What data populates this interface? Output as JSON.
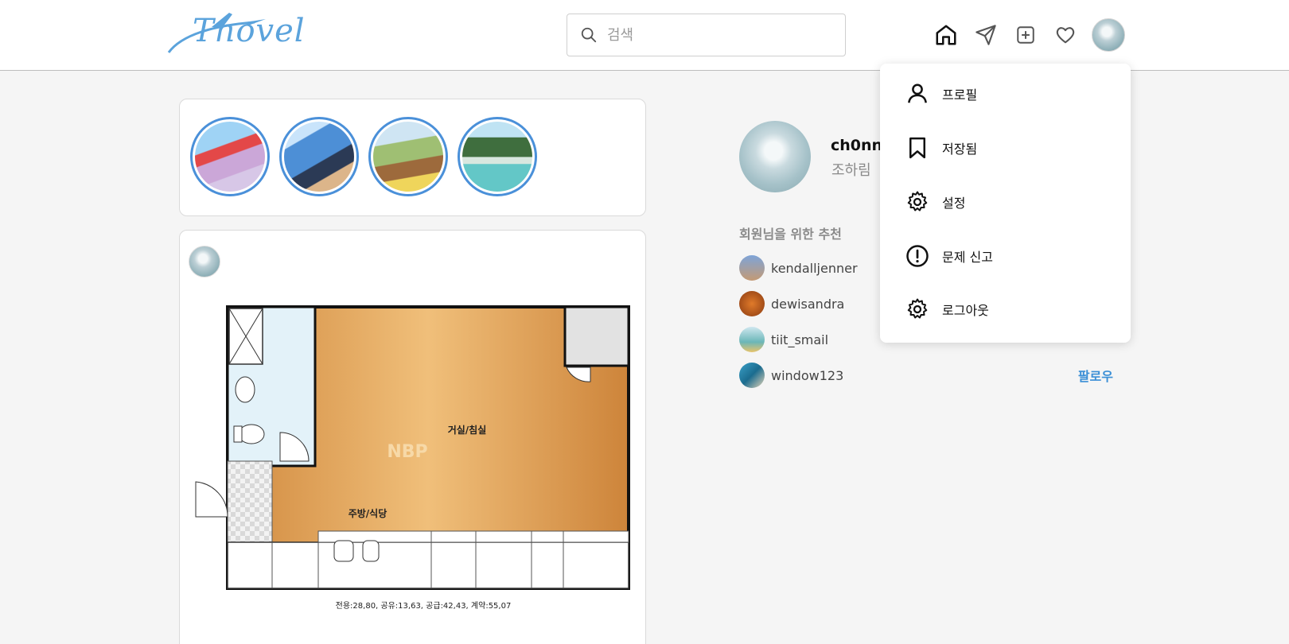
{
  "header": {
    "logo_text": "Tnovel",
    "search": {
      "placeholder": "검색",
      "value": ""
    },
    "icons": [
      "home-icon",
      "send-icon",
      "add-post-icon",
      "heart-icon",
      "profile-avatar"
    ]
  },
  "stories": [
    "story-1",
    "story-2",
    "story-3",
    "story-4"
  ],
  "post": {
    "floorplan": {
      "room_label": "거실/침실",
      "kitchen_label": "주방/식당",
      "watermark": "NBP",
      "area_caption": "전용:28,80, 공유:13,63, 공급:42,43, 계약:55,07"
    }
  },
  "sidebar": {
    "username": "ch0nn",
    "name": "조하림",
    "recommend_title": "회원님을 위한 추천",
    "recommendations": [
      {
        "username": "kendalljenner",
        "follow_label": ""
      },
      {
        "username": "dewisandra",
        "follow_label": ""
      },
      {
        "username": "tiit_smail",
        "follow_label": ""
      },
      {
        "username": "window123",
        "follow_label": "팔로우"
      }
    ]
  },
  "menu": {
    "items": [
      {
        "label": "프로필",
        "icon": "person-icon"
      },
      {
        "label": "저장됨",
        "icon": "bookmark-icon"
      },
      {
        "label": "설정",
        "icon": "gear-icon"
      },
      {
        "label": "문제 신고",
        "icon": "alert-circle-icon"
      },
      {
        "label": "로그아웃",
        "icon": "gear-icon"
      }
    ]
  },
  "colors": {
    "accent": "#3b8fd6",
    "logo": "#5ba3dc",
    "story_ring": "#4a90d9"
  }
}
